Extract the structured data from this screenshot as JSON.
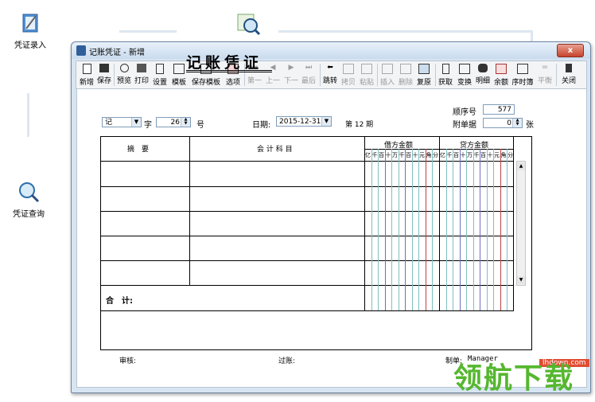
{
  "desktop": {
    "voucher_entry_label": "凭证录入",
    "voucher_query_label": "凭证查询"
  },
  "window": {
    "title": "记账凭证 - 新增",
    "close_label": "x"
  },
  "toolbar": {
    "new": "新增",
    "save": "保存",
    "preview": "预览",
    "print": "打印",
    "settings": "设置",
    "template": "模板",
    "save_template": "保存模板",
    "options": "选项",
    "first": "第一",
    "prev": "上一",
    "next": "下一",
    "last": "最后",
    "jump": "跳转",
    "copy": "拷贝",
    "paste": "粘贴",
    "insert": "插入",
    "delete": "删除",
    "restore": "复原",
    "fetch": "获取",
    "swap": "变换",
    "detail": "明细",
    "balance": "余额",
    "journal": "序时簿",
    "level": "平衡",
    "close": "关闭"
  },
  "voucher": {
    "title": "记账凭证",
    "type_value": "记",
    "zi_label": "字",
    "number_value": "26",
    "hao_label": "号",
    "date_label": "日期:",
    "date_value": "2015-12-31",
    "period_text": "第 12 期",
    "seq_label": "顺序号",
    "seq_value": "577",
    "attach_label": "附单据",
    "attach_value": "0",
    "zhang_label": "张"
  },
  "table": {
    "summary_header": "摘　要",
    "account_header": "会 计 科 目",
    "debit_header": "借方金额",
    "credit_header": "贷方金额",
    "digit_units": [
      "亿",
      "千",
      "百",
      "十",
      "万",
      "千",
      "百",
      "十",
      "元",
      "角",
      "分"
    ],
    "total_label": "合　计:"
  },
  "footer": {
    "audit_label": "审核:",
    "post_label": "过账:",
    "maker_label": "制单:",
    "maker_value": "Manager"
  },
  "watermark": {
    "text": "领航下载",
    "url": "lhdown.com"
  }
}
